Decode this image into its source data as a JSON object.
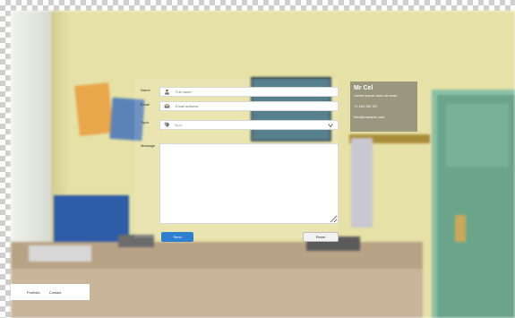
{
  "form": {
    "name_placeholder": "Full name",
    "email_placeholder": "Email address",
    "topic_value": "Topic",
    "message_label": "Message",
    "submit_label": "Send",
    "reset_label": "Reset",
    "side_labels": [
      "Name",
      "Email",
      "Topic",
      "Message"
    ]
  },
  "contact_card": {
    "title": "Mr Cel",
    "subtitle": "Lorem ipsum dolor sit amet",
    "line1": "+1 234 567 89",
    "line2": "info@example.com"
  },
  "footer": {
    "portfolio_label": "Portfolio",
    "contact_label": "Contact"
  },
  "colors": {
    "primary_button": "#2f7fd1",
    "info_card": "#9a977f"
  },
  "icons": {
    "name_field": "user-icon",
    "email_field": "mail-icon",
    "topic_field": "tag-icon",
    "select_arrow": "chevron-down-icon"
  }
}
